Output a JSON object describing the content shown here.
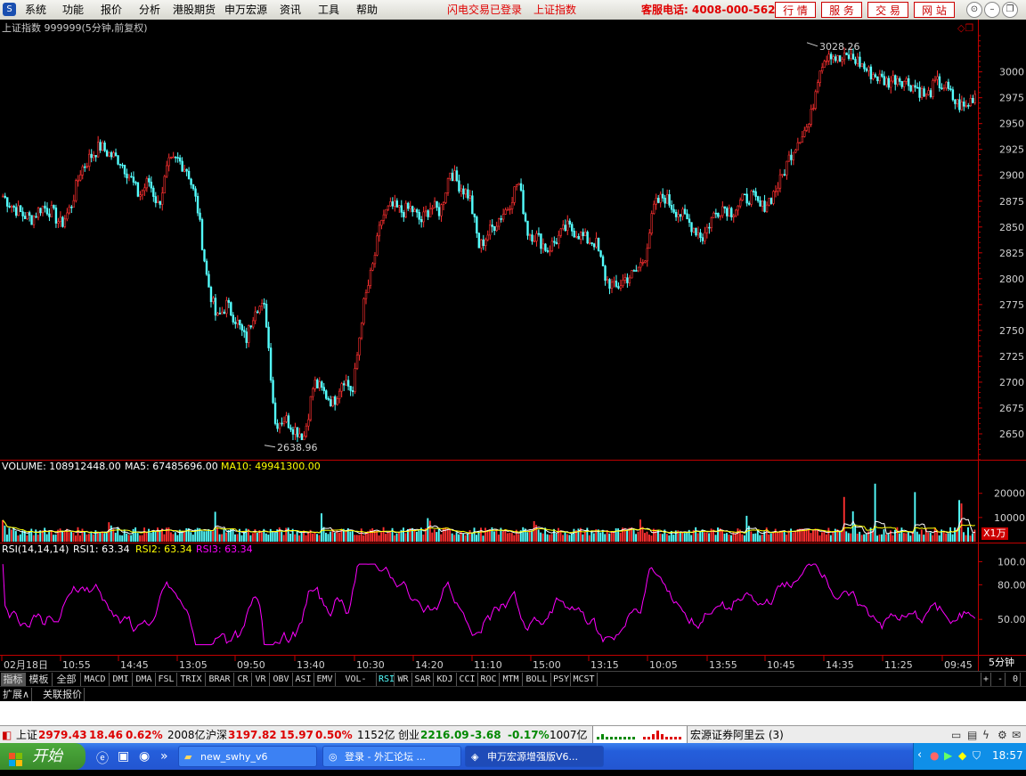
{
  "menu": {
    "items": [
      "系统",
      "功能",
      "报价",
      "分析",
      "港股期货",
      "申万宏源",
      "资讯",
      "工具",
      "帮助"
    ],
    "notice_login": "闪电交易已登录",
    "notice_index": "上证指数",
    "hotline": "客服电话: 4008-000-562",
    "buttons": [
      "行 情",
      "服 务",
      "交 易",
      "网 站"
    ]
  },
  "chart": {
    "title": "上证指数 999999(5分钟,前复权)",
    "high_label": "3028.26",
    "low_label": "2638.96",
    "price_axis": [
      "3000",
      "2975",
      "2950",
      "2925",
      "2900",
      "2875",
      "2850",
      "2825",
      "2800",
      "2775",
      "2750",
      "2725",
      "2700",
      "2675",
      "2650"
    ],
    "volume_label": "VOLUME: 108912448.00",
    "ma5_label": "MA5: 67485696.00",
    "ma10_label": "MA10: 49941300.00",
    "volume_axis": [
      "20000",
      "10000"
    ],
    "volume_unit": "X1万",
    "rsi_params": "RSI(14,14,14)",
    "rsi1_label": "RSI1: 63.34",
    "rsi2_label": "RSI2: 63.34",
    "rsi3_label": "RSI3: 63.34",
    "rsi_axis": [
      "100.00",
      "80.00",
      "50.00"
    ],
    "time_axis": [
      "02月18日",
      "10:55",
      "14:45",
      "13:05",
      "09:50",
      "13:40",
      "10:30",
      "14:20",
      "11:10",
      "15:00",
      "13:15",
      "10:05",
      "13:55",
      "10:45",
      "14:35",
      "11:25",
      "09:45"
    ],
    "period_label": "5分钟"
  },
  "chart_data": [
    {
      "type": "candlestick",
      "title": "上证指数 999999(5分钟,前复权)",
      "ylim": [
        2625,
        3035
      ],
      "y_ticks": [
        2650,
        2675,
        2700,
        2725,
        2750,
        2775,
        2800,
        2825,
        2850,
        2875,
        2900,
        2925,
        2950,
        2975,
        3000
      ],
      "x_labels": [
        "02月18日",
        "10:55",
        "14:45",
        "13:05",
        "09:50",
        "13:40",
        "10:30",
        "14:20",
        "11:10",
        "15:00",
        "13:15",
        "10:05",
        "13:55",
        "10:45",
        "14:35",
        "11:25",
        "09:45"
      ],
      "close_path": [
        2880,
        2870,
        2862,
        2858,
        2870,
        2865,
        2852,
        2870,
        2905,
        2918,
        2928,
        2920,
        2915,
        2900,
        2880,
        2895,
        2870,
        2910,
        2915,
        2905,
        2870,
        2800,
        2760,
        2775,
        2760,
        2740,
        2775,
        2770,
        2660,
        2665,
        2655,
        2648,
        2700,
        2690,
        2680,
        2705,
        2690,
        2770,
        2810,
        2860,
        2870,
        2865,
        2868,
        2855,
        2870,
        2865,
        2905,
        2890,
        2880,
        2830,
        2845,
        2858,
        2870,
        2895,
        2845,
        2840,
        2828,
        2838,
        2850,
        2845,
        2838,
        2835,
        2800,
        2790,
        2800,
        2805,
        2820,
        2870,
        2880,
        2868,
        2860,
        2850,
        2840,
        2860,
        2870,
        2865,
        2875,
        2880,
        2868,
        2878,
        2895,
        2920,
        2938,
        2950,
        3005,
        3020,
        3010,
        3015,
        3010,
        3000,
        2995,
        2990,
        2995,
        2990,
        2985,
        2975,
        2990,
        2985,
        2970,
        2965,
        2979
      ],
      "annotations": [
        {
          "text": "3028.26",
          "value": 3028.26
        },
        {
          "text": "2638.96",
          "value": 2638.96
        }
      ]
    },
    {
      "type": "bar",
      "title": "VOLUME: 108912448.00",
      "ylim": [
        0,
        28000
      ],
      "y_ticks": [
        10000,
        20000
      ],
      "unit": "X1万",
      "series": [
        {
          "name": "MA5: 67485696.00",
          "color": "#ffffff"
        },
        {
          "name": "MA10: 49941300.00",
          "color": "#ffff00"
        }
      ]
    },
    {
      "type": "line",
      "title": "RSI(14,14,14)",
      "ylim": [
        20,
        105
      ],
      "y_ticks": [
        50,
        80,
        100
      ],
      "series": [
        {
          "name": "RSI1: 63.34",
          "color": "#ffffff"
        },
        {
          "name": "RSI2: 63.34",
          "color": "#ffff00"
        },
        {
          "name": "RSI3: 63.34",
          "color": "#ff00ff"
        }
      ]
    }
  ],
  "indicator_tabs": [
    "指标",
    "模板",
    "全部",
    "MACD",
    "DMI",
    "DMA",
    "FSL",
    "TRIX",
    "BRAR",
    "CR",
    "VR",
    "OBV",
    "ASI",
    "EMV",
    "VOL-TDX",
    "RSI",
    "WR",
    "SAR",
    "KDJ",
    "CCI",
    "ROC",
    "MTM",
    "BOLL",
    "PSY",
    "MCST"
  ],
  "indicator_active": "RSI",
  "indicator_right": [
    "+",
    "-",
    "0"
  ],
  "ext_tabs": [
    "扩展∧",
    "关联报价"
  ],
  "status": {
    "sh_name": "上证",
    "sh_price": "2979.43",
    "sh_change": "18.46",
    "sh_pct": "0.62%",
    "sh_amount": "2008亿",
    "hs_name": "沪深",
    "hs_price": "3197.82",
    "hs_change": "15.97",
    "hs_pct": "0.50%",
    "hs_amount": "1152亿",
    "cy_name": "创业",
    "cy_price": "2216.09",
    "cy_change": "-3.68",
    "cy_pct": "-0.17%",
    "cy_amount": "1007亿",
    "server": "宏源证券阿里云 (3)"
  },
  "taskbar": {
    "start": "开始",
    "tasks": [
      "new_swhy_v6",
      "登录 - 外汇论坛 ...",
      "申万宏源增强版V6..."
    ],
    "clock": "18:57"
  },
  "colors": {
    "up": "#ff3030",
    "down": "#54ffff",
    "accent_red": "#e00000",
    "axis_red": "#c00000",
    "rsi": "#ff00ff",
    "ma10": "#ffff00"
  }
}
